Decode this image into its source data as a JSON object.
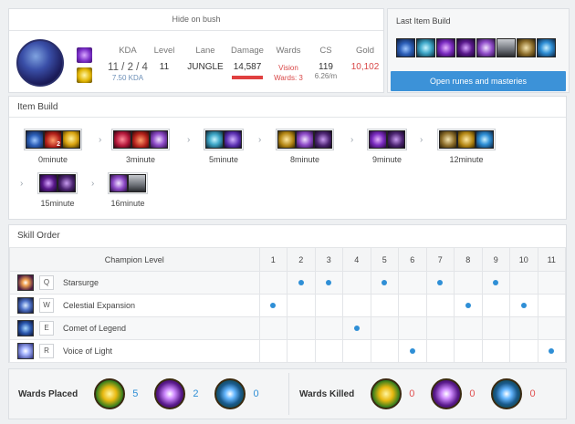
{
  "summoner": "Hide on bush",
  "stats": {
    "kda_label": "KDA",
    "kda": "11 / 2 / 4",
    "kda_ratio": "7.50 KDA",
    "level_label": "Level",
    "level": "11",
    "lane_label": "Lane",
    "lane": "JUNGLE",
    "damage_label": "Damage",
    "damage": "14,587",
    "wards_label": "Wards",
    "vision": "Vision",
    "vision_wards": "Wards: 3",
    "cs_label": "CS",
    "cs": "119",
    "cs_per_min": "6.26/m",
    "gold_label": "Gold",
    "gold": "10,102"
  },
  "last_item_build": {
    "title": "Last Item Build",
    "items": [
      "boots-icon",
      "crystal-icon",
      "staff-icon",
      "dark-staff-icon",
      "eye-icon",
      "chest-icon",
      "claws-icon",
      "orb-icon"
    ]
  },
  "runes_button": "Open runes and masteries",
  "item_build": {
    "title": "Item Build",
    "steps": [
      {
        "label": "0minute",
        "items": [
          "boots-icon",
          "potion-icon",
          "trinket-icon"
        ],
        "potion_count": "2"
      },
      {
        "label": "3minute",
        "items": [
          "red-blade-icon",
          "potion-icon",
          "eye-icon"
        ]
      },
      {
        "label": "5minute",
        "items": [
          "crystal-icon",
          "purple-icon"
        ]
      },
      {
        "label": "8minute",
        "items": [
          "gold-icon",
          "eye-icon",
          "dark-icon"
        ]
      },
      {
        "label": "9minute",
        "items": [
          "staff-icon",
          "dark-icon"
        ]
      },
      {
        "label": "12minute",
        "items": [
          "claws-icon",
          "gold-icon",
          "orb-icon"
        ]
      },
      {
        "label": "15minute",
        "items": [
          "dark-staff-icon",
          "dark-icon"
        ]
      },
      {
        "label": "16minute",
        "items": [
          "eye-icon",
          "chest-icon"
        ]
      }
    ]
  },
  "skill_order": {
    "title": "Skill Order",
    "header": "Champion Level",
    "levels": [
      "1",
      "2",
      "3",
      "4",
      "5",
      "6",
      "7",
      "8",
      "9",
      "10",
      "11"
    ],
    "skills": [
      {
        "key": "Q",
        "name": "Starsurge",
        "levels": [
          2,
          3,
          5,
          7,
          9
        ]
      },
      {
        "key": "W",
        "name": "Celestial Expansion",
        "levels": [
          1,
          8,
          10
        ]
      },
      {
        "key": "E",
        "name": "Comet of Legend",
        "levels": [
          4
        ]
      },
      {
        "key": "R",
        "name": "Voice of Light",
        "levels": [
          6,
          11
        ]
      }
    ]
  },
  "wards": {
    "placed_label": "Wards Placed",
    "placed": [
      "5",
      "2",
      "0"
    ],
    "killed_label": "Wards Killed",
    "killed": [
      "0",
      "0",
      "0"
    ]
  },
  "colors": {
    "accent": "#3c92d8",
    "danger": "#e04040",
    "dot": "#2f8fd6"
  }
}
